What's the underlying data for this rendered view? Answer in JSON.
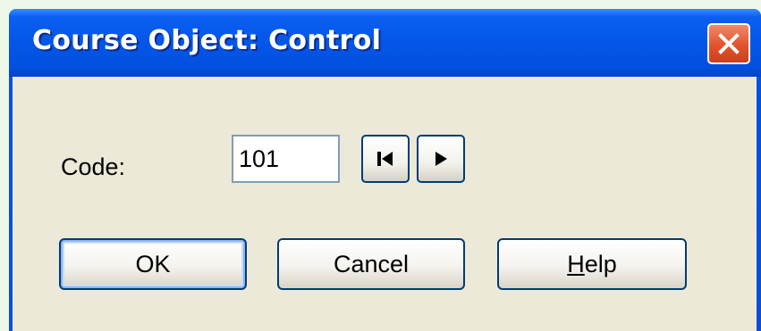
{
  "window": {
    "title": "Course Object: Control"
  },
  "form": {
    "code_label": "Code:",
    "code_value": "101"
  },
  "buttons": {
    "ok_label": "OK",
    "cancel_label": "Cancel",
    "help_mnemonic": "H",
    "help_rest": "elp"
  },
  "icons": {
    "close": "close-icon",
    "first": "skip-to-first-icon",
    "next": "play-next-icon"
  },
  "colors": {
    "titlebar": "#0456e8",
    "close_button": "#e2532b",
    "dialog_face": "#ece9d8",
    "button_border": "#003c74"
  }
}
